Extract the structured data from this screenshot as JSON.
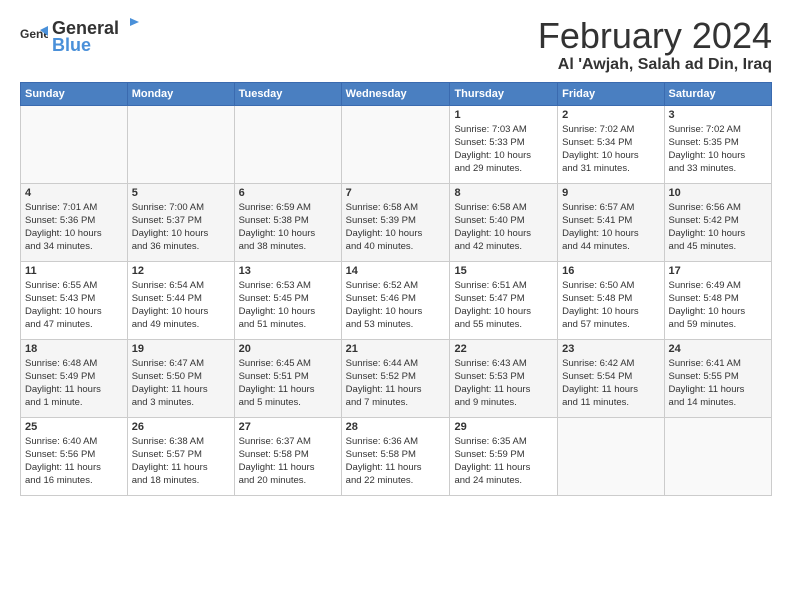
{
  "logo": {
    "general": "General",
    "blue": "Blue"
  },
  "header": {
    "month": "February 2024",
    "location": "Al 'Awjah, Salah ad Din, Iraq"
  },
  "weekdays": [
    "Sunday",
    "Monday",
    "Tuesday",
    "Wednesday",
    "Thursday",
    "Friday",
    "Saturday"
  ],
  "weeks": [
    [
      {
        "day": "",
        "info": ""
      },
      {
        "day": "",
        "info": ""
      },
      {
        "day": "",
        "info": ""
      },
      {
        "day": "",
        "info": ""
      },
      {
        "day": "1",
        "info": "Sunrise: 7:03 AM\nSunset: 5:33 PM\nDaylight: 10 hours\nand 29 minutes."
      },
      {
        "day": "2",
        "info": "Sunrise: 7:02 AM\nSunset: 5:34 PM\nDaylight: 10 hours\nand 31 minutes."
      },
      {
        "day": "3",
        "info": "Sunrise: 7:02 AM\nSunset: 5:35 PM\nDaylight: 10 hours\nand 33 minutes."
      }
    ],
    [
      {
        "day": "4",
        "info": "Sunrise: 7:01 AM\nSunset: 5:36 PM\nDaylight: 10 hours\nand 34 minutes."
      },
      {
        "day": "5",
        "info": "Sunrise: 7:00 AM\nSunset: 5:37 PM\nDaylight: 10 hours\nand 36 minutes."
      },
      {
        "day": "6",
        "info": "Sunrise: 6:59 AM\nSunset: 5:38 PM\nDaylight: 10 hours\nand 38 minutes."
      },
      {
        "day": "7",
        "info": "Sunrise: 6:58 AM\nSunset: 5:39 PM\nDaylight: 10 hours\nand 40 minutes."
      },
      {
        "day": "8",
        "info": "Sunrise: 6:58 AM\nSunset: 5:40 PM\nDaylight: 10 hours\nand 42 minutes."
      },
      {
        "day": "9",
        "info": "Sunrise: 6:57 AM\nSunset: 5:41 PM\nDaylight: 10 hours\nand 44 minutes."
      },
      {
        "day": "10",
        "info": "Sunrise: 6:56 AM\nSunset: 5:42 PM\nDaylight: 10 hours\nand 45 minutes."
      }
    ],
    [
      {
        "day": "11",
        "info": "Sunrise: 6:55 AM\nSunset: 5:43 PM\nDaylight: 10 hours\nand 47 minutes."
      },
      {
        "day": "12",
        "info": "Sunrise: 6:54 AM\nSunset: 5:44 PM\nDaylight: 10 hours\nand 49 minutes."
      },
      {
        "day": "13",
        "info": "Sunrise: 6:53 AM\nSunset: 5:45 PM\nDaylight: 10 hours\nand 51 minutes."
      },
      {
        "day": "14",
        "info": "Sunrise: 6:52 AM\nSunset: 5:46 PM\nDaylight: 10 hours\nand 53 minutes."
      },
      {
        "day": "15",
        "info": "Sunrise: 6:51 AM\nSunset: 5:47 PM\nDaylight: 10 hours\nand 55 minutes."
      },
      {
        "day": "16",
        "info": "Sunrise: 6:50 AM\nSunset: 5:48 PM\nDaylight: 10 hours\nand 57 minutes."
      },
      {
        "day": "17",
        "info": "Sunrise: 6:49 AM\nSunset: 5:48 PM\nDaylight: 10 hours\nand 59 minutes."
      }
    ],
    [
      {
        "day": "18",
        "info": "Sunrise: 6:48 AM\nSunset: 5:49 PM\nDaylight: 11 hours\nand 1 minute."
      },
      {
        "day": "19",
        "info": "Sunrise: 6:47 AM\nSunset: 5:50 PM\nDaylight: 11 hours\nand 3 minutes."
      },
      {
        "day": "20",
        "info": "Sunrise: 6:45 AM\nSunset: 5:51 PM\nDaylight: 11 hours\nand 5 minutes."
      },
      {
        "day": "21",
        "info": "Sunrise: 6:44 AM\nSunset: 5:52 PM\nDaylight: 11 hours\nand 7 minutes."
      },
      {
        "day": "22",
        "info": "Sunrise: 6:43 AM\nSunset: 5:53 PM\nDaylight: 11 hours\nand 9 minutes."
      },
      {
        "day": "23",
        "info": "Sunrise: 6:42 AM\nSunset: 5:54 PM\nDaylight: 11 hours\nand 11 minutes."
      },
      {
        "day": "24",
        "info": "Sunrise: 6:41 AM\nSunset: 5:55 PM\nDaylight: 11 hours\nand 14 minutes."
      }
    ],
    [
      {
        "day": "25",
        "info": "Sunrise: 6:40 AM\nSunset: 5:56 PM\nDaylight: 11 hours\nand 16 minutes."
      },
      {
        "day": "26",
        "info": "Sunrise: 6:38 AM\nSunset: 5:57 PM\nDaylight: 11 hours\nand 18 minutes."
      },
      {
        "day": "27",
        "info": "Sunrise: 6:37 AM\nSunset: 5:58 PM\nDaylight: 11 hours\nand 20 minutes."
      },
      {
        "day": "28",
        "info": "Sunrise: 6:36 AM\nSunset: 5:58 PM\nDaylight: 11 hours\nand 22 minutes."
      },
      {
        "day": "29",
        "info": "Sunrise: 6:35 AM\nSunset: 5:59 PM\nDaylight: 11 hours\nand 24 minutes."
      },
      {
        "day": "",
        "info": ""
      },
      {
        "day": "",
        "info": ""
      }
    ]
  ]
}
